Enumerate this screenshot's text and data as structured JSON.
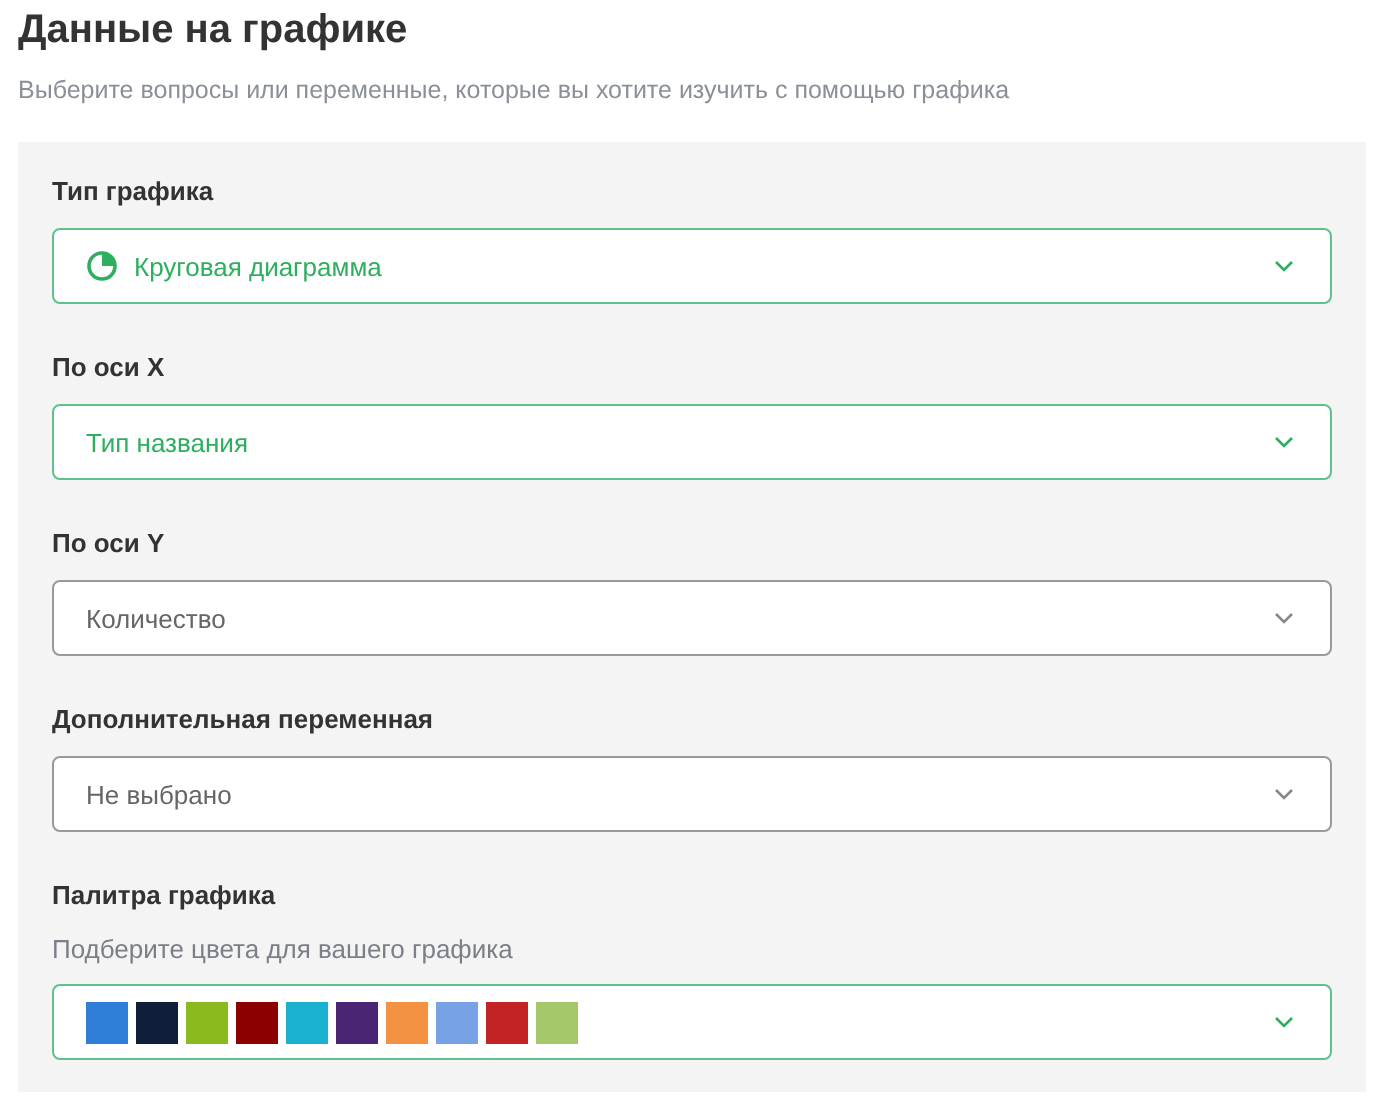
{
  "title": "Данные на графике",
  "subtitle": "Выберите вопросы или переменные, которые вы хотите изучить с помощью графика",
  "fields": [
    {
      "kind": "icon-select",
      "label": "Тип графика",
      "value": "Круговая диаграмма",
      "active": true
    },
    {
      "kind": "select",
      "label": "По оси X",
      "value": "Тип названия",
      "active": true
    },
    {
      "kind": "select",
      "label": "По оси Y",
      "value": "Количество",
      "active": false
    },
    {
      "kind": "select",
      "label": "Дополнительная переменная",
      "value": "Не выбрано",
      "active": false
    },
    {
      "kind": "palette",
      "label": "Палитра графика",
      "hint": "Подберите цвета для вашего графика",
      "active": true,
      "swatches": [
        {
          "color": "#2f7fd8"
        },
        {
          "color": "#0f1f3a"
        },
        {
          "color": "#8aba1e"
        },
        {
          "color": "#8c0000"
        },
        {
          "color": "#1ab0d0"
        },
        {
          "color": "#4a2574"
        },
        {
          "color": "#f39243"
        },
        {
          "color": "#78a2e6"
        },
        {
          "color": "#c42326"
        },
        {
          "color": "#a5c96a"
        }
      ]
    }
  ]
}
